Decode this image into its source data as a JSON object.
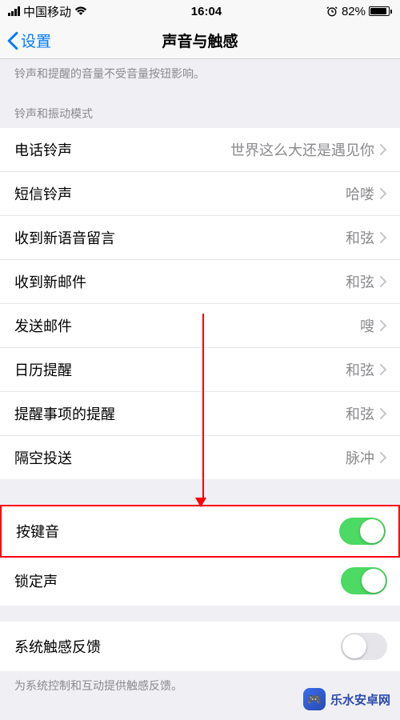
{
  "status": {
    "carrier": "中国移动",
    "time": "16:04",
    "battery_pct": "82%"
  },
  "nav": {
    "back_label": "设置",
    "title": "声音与触感"
  },
  "intro_text": "铃声和提醒的音量不受音量按钮影响。",
  "section1_header": "铃声和振动模式",
  "rows": {
    "ringtone": {
      "label": "电话铃声",
      "value": "世界这么大还是遇见你"
    },
    "text_tone": {
      "label": "短信铃声",
      "value": "哈喽"
    },
    "voicemail": {
      "label": "收到新语音留言",
      "value": "和弦"
    },
    "newmail": {
      "label": "收到新邮件",
      "value": "和弦"
    },
    "sentmail": {
      "label": "发送邮件",
      "value": "嗖"
    },
    "calendar": {
      "label": "日历提醒",
      "value": "和弦"
    },
    "reminder": {
      "label": "提醒事项的提醒",
      "value": "和弦"
    },
    "airdrop": {
      "label": "隔空投送",
      "value": "脉冲"
    }
  },
  "toggles": {
    "keyboard": {
      "label": "按键音"
    },
    "lock": {
      "label": "锁定声"
    },
    "haptic": {
      "label": "系统触感反馈"
    }
  },
  "footer_text": "为系统控制和互动提供触感反馈。",
  "watermark": "乐水安卓网"
}
